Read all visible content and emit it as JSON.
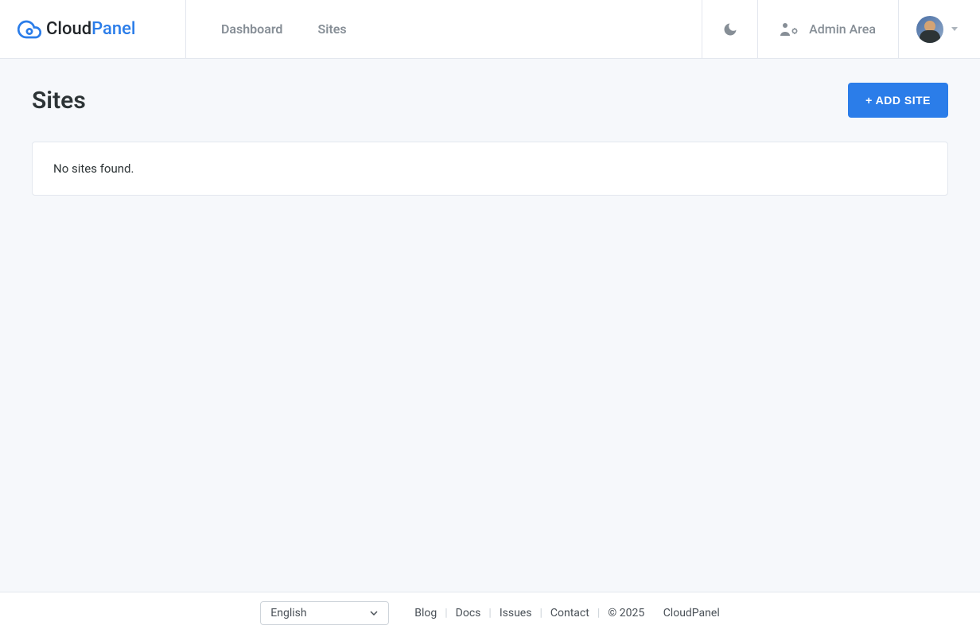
{
  "header": {
    "logo": {
      "cloud": "Cloud",
      "panel": "Panel"
    },
    "nav": {
      "dashboard": "Dashboard",
      "sites": "Sites"
    },
    "admin_area": "Admin Area"
  },
  "page": {
    "title": "Sites",
    "add_button": "+ ADD SITE",
    "empty_message": "No sites found."
  },
  "footer": {
    "language": "English",
    "links": {
      "blog": "Blog",
      "docs": "Docs",
      "issues": "Issues",
      "contact": "Contact"
    },
    "copyright": "© 2025",
    "brand": "CloudPanel"
  }
}
